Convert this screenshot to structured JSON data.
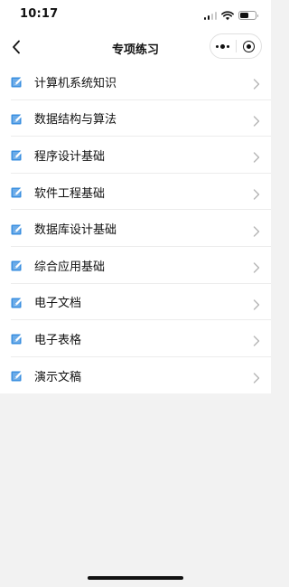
{
  "status_bar": {
    "time": "10:17",
    "icons": [
      "cellular-signal-icon",
      "wifi-icon",
      "battery-icon"
    ],
    "battery_level": 0.6
  },
  "nav": {
    "title": "专项练习",
    "icons": [
      "back-chevron-icon",
      "more-dots-icon",
      "close-target-icon"
    ]
  },
  "colors": {
    "icon_blue": "#3a8fe0",
    "background": "#f2f2f2",
    "divider": "#ececec"
  },
  "list": {
    "item_icon": "edit-note-icon",
    "trailing_icon": "chevron-right-icon",
    "items": [
      {
        "label": "计算机系统知识"
      },
      {
        "label": "数据结构与算法"
      },
      {
        "label": "程序设计基础"
      },
      {
        "label": "软件工程基础"
      },
      {
        "label": "数据库设计基础"
      },
      {
        "label": "综合应用基础"
      },
      {
        "label": "电子文档"
      },
      {
        "label": "电子表格"
      },
      {
        "label": "演示文稿"
      }
    ]
  }
}
